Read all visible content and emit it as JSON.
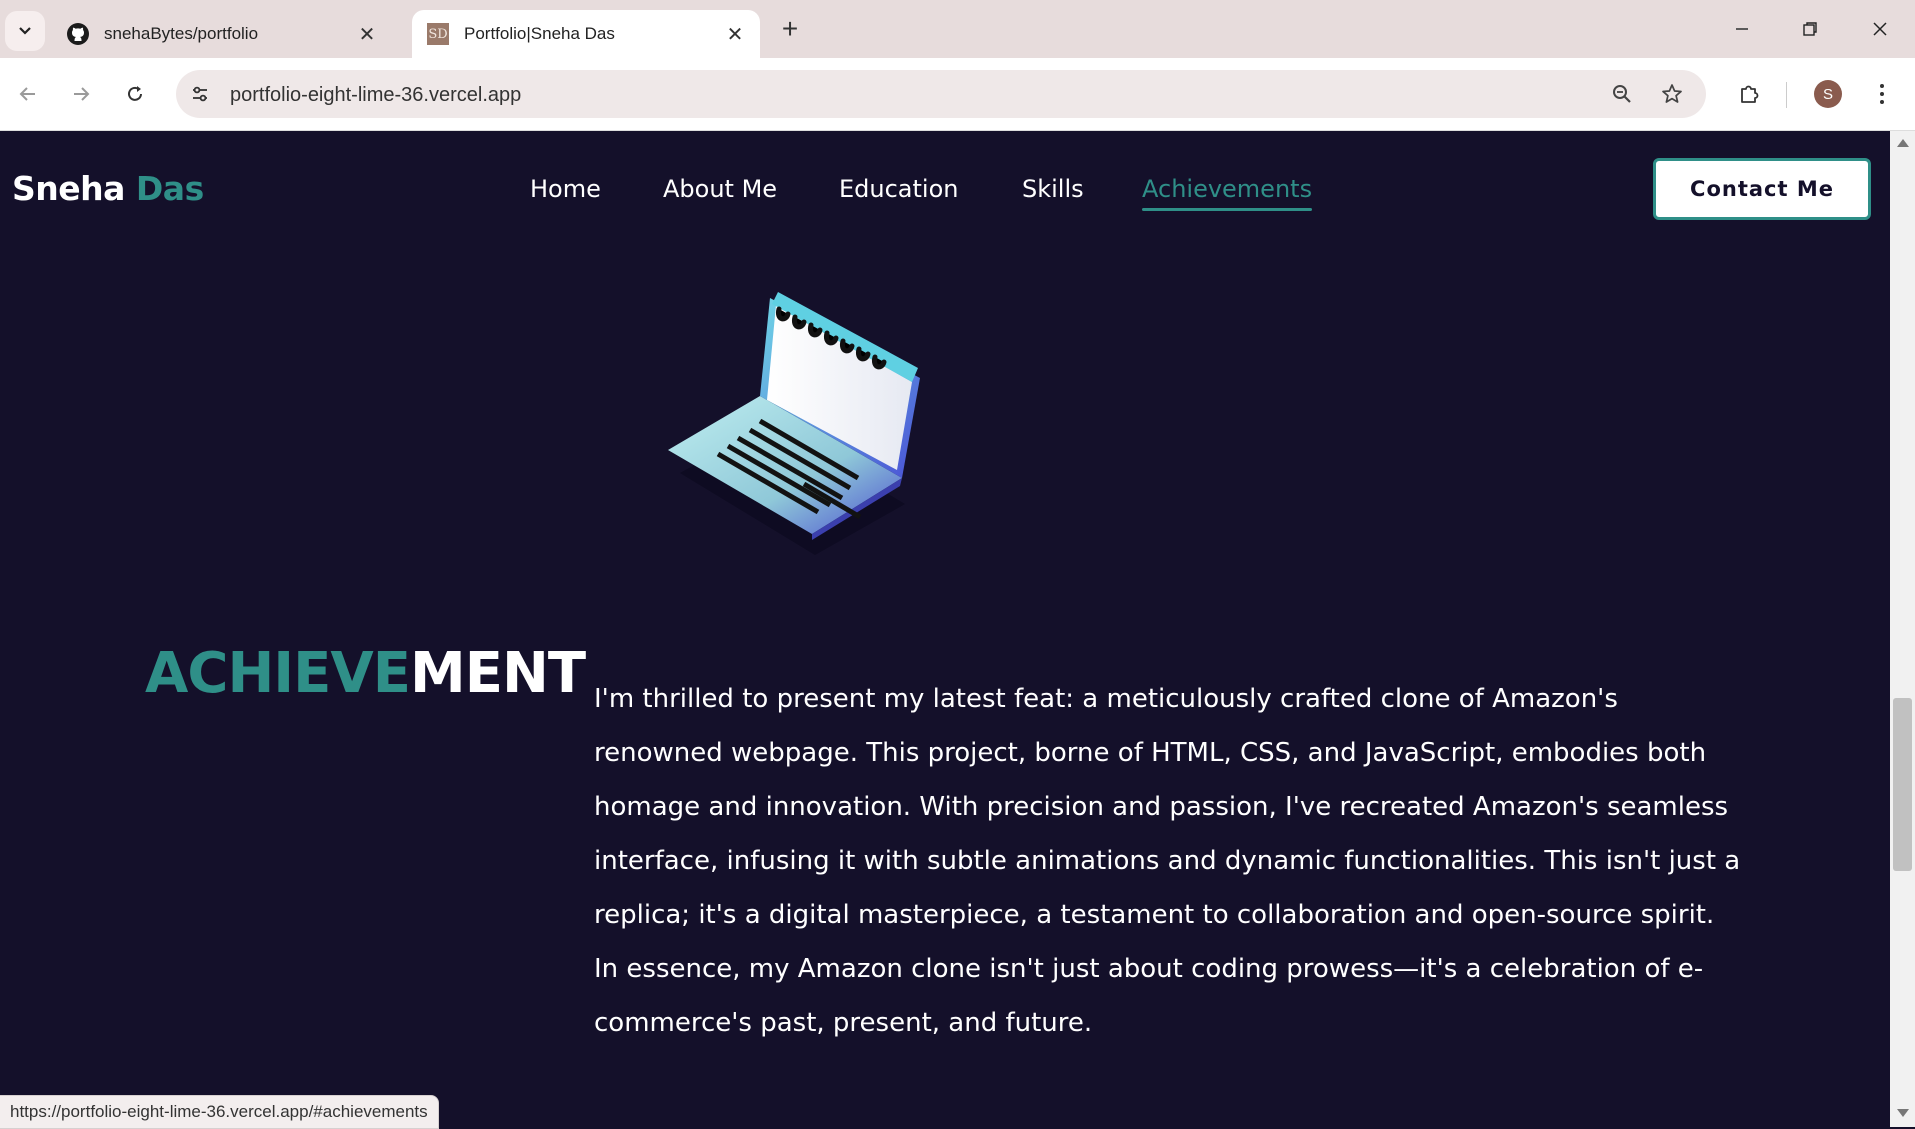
{
  "browser": {
    "tabs": [
      {
        "title": "snehaBytes/portfolio",
        "favicon": "github-icon"
      },
      {
        "title": "Portfolio|Sneha Das",
        "favicon": "sd-favicon",
        "favicon_text": "SD",
        "active": true
      }
    ],
    "url": "portfolio-eight-lime-36.vercel.app",
    "profile_initial": "S",
    "status_url": "https://portfolio-eight-lime-36.vercel.app/#achievements"
  },
  "site": {
    "brand_first": "Sneha",
    "brand_last": "Das",
    "nav": [
      "Home",
      "About Me",
      "Education",
      "Skills",
      "Achievements"
    ],
    "active_nav": "Achievements",
    "contact_label": "Contact Me"
  },
  "section": {
    "heading_part1": "ACHIEVE",
    "heading_part2": "MENT",
    "description": "I'm thrilled to present my latest feat: a meticulously crafted clone of Amazon's renowned webpage. This project, borne of HTML, CSS, and JavaScript, embodies both homage and innovation. With precision and passion, I've recreated Amazon's seamless interface, infusing it with subtle animations and dynamic functionalities. This isn't just a replica; it's a digital masterpiece, a testament to collaboration and open-source spirit. In essence, my Amazon clone isn't just about coding prowess—it's a celebration of e-commerce's past, present, and future."
  },
  "colors": {
    "page_bg": "#14102a",
    "accent": "#2f8f88",
    "text": "#ffffff"
  }
}
